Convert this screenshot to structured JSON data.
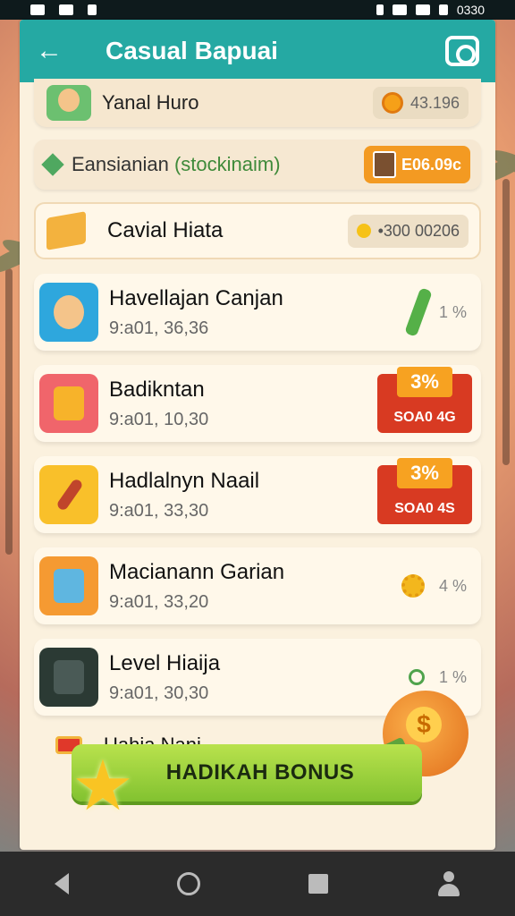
{
  "status_bar": {
    "time": "0330"
  },
  "app_bar": {
    "title": "Casual Bapuai",
    "back_label": "←"
  },
  "top_row": {
    "name": "Yanal Huro",
    "value": "43.196"
  },
  "summary_row": {
    "label_main": "Eansianian ",
    "label_green": "(stockinaim)",
    "value": "E06.09c"
  },
  "featured": {
    "label": "Cavial Hiata",
    "value": "•300 00206"
  },
  "items": [
    {
      "title": "Havellajan Canjan",
      "subtitle": "9:a01, 36,36",
      "right": "1 %",
      "kind": "wrench"
    },
    {
      "title": "Badikntan",
      "subtitle": "9:a01, 10,30",
      "badge_pct": "3%",
      "badge_amt": "SOA0 4G",
      "kind": "badge"
    },
    {
      "title": "Hadlalnyn Naail",
      "subtitle": "9:a01, 33,30",
      "badge_pct": "3%",
      "badge_amt": "SOA0 4S",
      "kind": "badge"
    },
    {
      "title": "Macianann Garian",
      "subtitle": "9:a01, 33,20",
      "right": "4 %",
      "kind": "gear"
    },
    {
      "title": "Level Hiaija",
      "subtitle": "9:a01, 30,30",
      "right": "1 %",
      "kind": "ring"
    }
  ],
  "last_row": {
    "label": "Uahia Nani"
  },
  "bonus_button": {
    "label": "HADIKAH BONUS"
  },
  "money_symbol": "$"
}
